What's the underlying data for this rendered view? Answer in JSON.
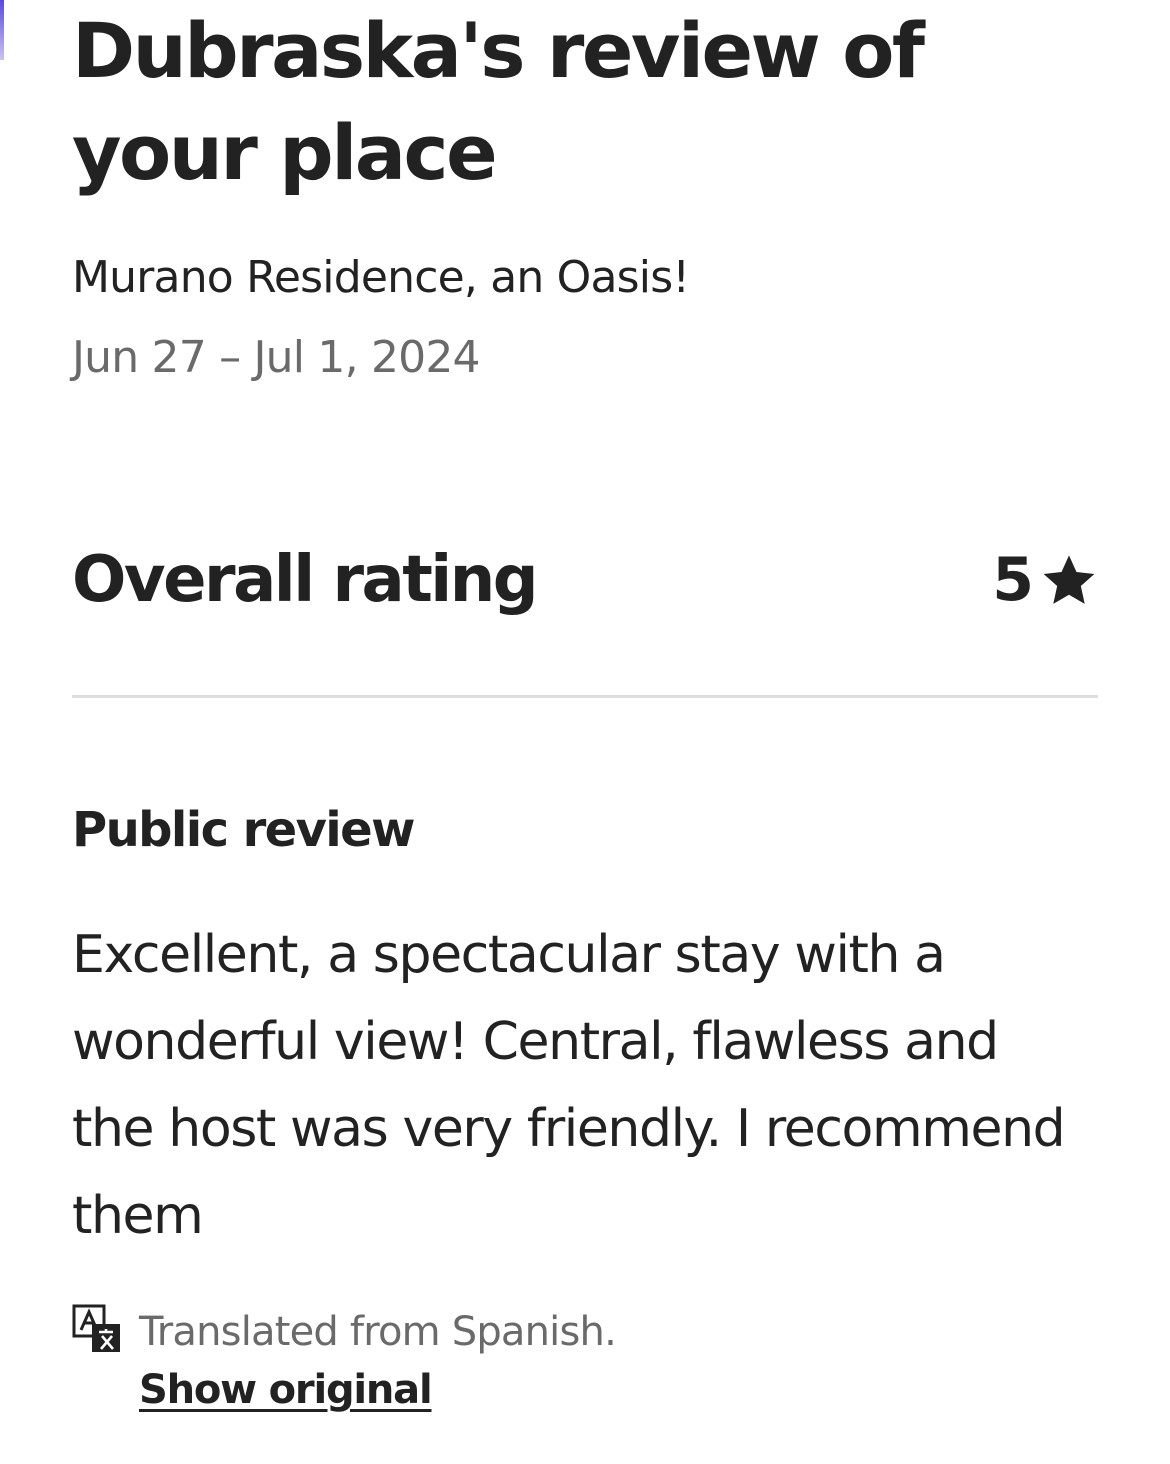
{
  "header": {
    "title": "Dubraska's review of your place",
    "listing_name": "Murano Residence, an Oasis!",
    "stay_dates": "Jun 27 – Jul 1, 2024"
  },
  "rating": {
    "label": "Overall rating",
    "value": "5",
    "icon": "star-icon"
  },
  "public_review": {
    "section_title": "Public review",
    "text": "Excellent, a spectacular stay with a wonderful view! Central, flawless and the host was very friendly. I recommend them"
  },
  "translation": {
    "icon": "translate-icon",
    "note": "Translated from Spanish.",
    "show_original_label": "Show original"
  },
  "colors": {
    "primary_text": "#222222",
    "secondary_text": "#6a6a6a",
    "divider": "#dddddd"
  }
}
